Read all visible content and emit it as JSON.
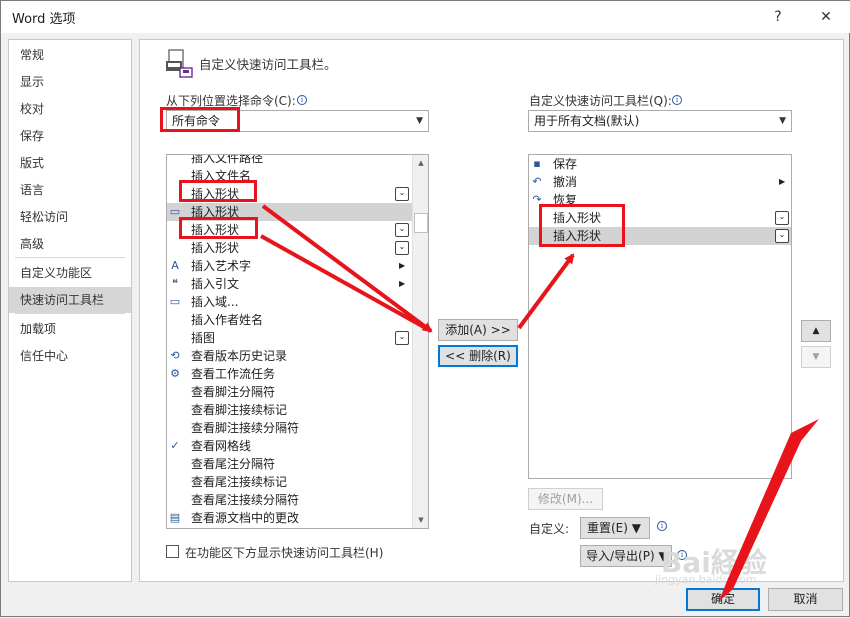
{
  "window": {
    "title": "Word 选项",
    "help_label": "?",
    "close_label": "✕"
  },
  "nav": {
    "items": [
      {
        "label": "常规"
      },
      {
        "label": "显示"
      },
      {
        "label": "校对"
      },
      {
        "label": "保存"
      },
      {
        "label": "版式"
      },
      {
        "label": "语言"
      },
      {
        "label": "轻松访问"
      },
      {
        "label": "高级"
      },
      {
        "label": "自定义功能区"
      },
      {
        "label": "快速访问工具栏",
        "selected": true
      },
      {
        "label": "加载项"
      },
      {
        "label": "信任中心"
      }
    ]
  },
  "main": {
    "heading": "自定义快速访问工具栏。",
    "choose_from_label": "从下列位置选择命令(C):",
    "choose_from_value": "所有命令",
    "customize_label": "自定义快速访问工具栏(Q):",
    "customize_value": "用于所有文档(默认)",
    "commands": [
      {
        "label": "插入文件路径",
        "icon": ""
      },
      {
        "label": "插入文件名",
        "icon": ""
      },
      {
        "label": "插入形状",
        "icon": "",
        "flyout": true
      },
      {
        "label": "插入形状",
        "icon": "shape-icon",
        "highlighted": true
      },
      {
        "label": "插入形状",
        "icon": "",
        "flyout": true
      },
      {
        "label": "插入形状",
        "icon": "",
        "flyout": true
      },
      {
        "label": "插入艺术字",
        "icon": "wordart-icon",
        "submenu": true
      },
      {
        "label": "插入引文",
        "icon": "citation-icon",
        "submenu": true
      },
      {
        "label": "插入域...",
        "icon": "field-icon"
      },
      {
        "label": "插入作者姓名",
        "icon": ""
      },
      {
        "label": "插图",
        "icon": "",
        "flyout": true
      },
      {
        "label": "查看版本历史记录",
        "icon": "history-icon"
      },
      {
        "label": "查看工作流任务",
        "icon": "workflow-icon"
      },
      {
        "label": "查看脚注分隔符",
        "icon": ""
      },
      {
        "label": "查看脚注接续标记",
        "icon": ""
      },
      {
        "label": "查看脚注接续分隔符",
        "icon": ""
      },
      {
        "label": "查看网格线",
        "icon": "check-icon"
      },
      {
        "label": "查看尾注分隔符",
        "icon": ""
      },
      {
        "label": "查看尾注接续标记",
        "icon": ""
      },
      {
        "label": "查看尾注接续分隔符",
        "icon": ""
      },
      {
        "label": "查看源文档中的更改",
        "icon": "compare-icon"
      }
    ],
    "toolbar_items": [
      {
        "label": "保存",
        "icon": "save-icon"
      },
      {
        "label": "撤消",
        "icon": "undo-icon",
        "submenu": true
      },
      {
        "label": "恢复",
        "icon": "redo-icon"
      },
      {
        "label": "插入形状",
        "icon": "",
        "flyout": true
      },
      {
        "label": "插入形状",
        "icon": "",
        "flyout": true,
        "highlighted": true
      }
    ],
    "add_button": "添加(A) >>",
    "remove_button": "<< 删除(R)",
    "modify_button": "修改(M)...",
    "customizations_label": "自定义:",
    "reset_button": "重置(E) ▼",
    "import_export_button": "导入/导出(P) ▼",
    "show_below_ribbon_label": "在功能区下方显示快速访问工具栏(H)"
  },
  "footer": {
    "ok_button": "确定",
    "cancel_button": "取消"
  },
  "watermark": {
    "logo_text": "Bai経验",
    "url": "jingyan.baidu.com"
  },
  "colors": {
    "annotation_red": "#e8141b",
    "highlight": "#d3d3d3",
    "selected_nav": "#d6d6d6"
  }
}
